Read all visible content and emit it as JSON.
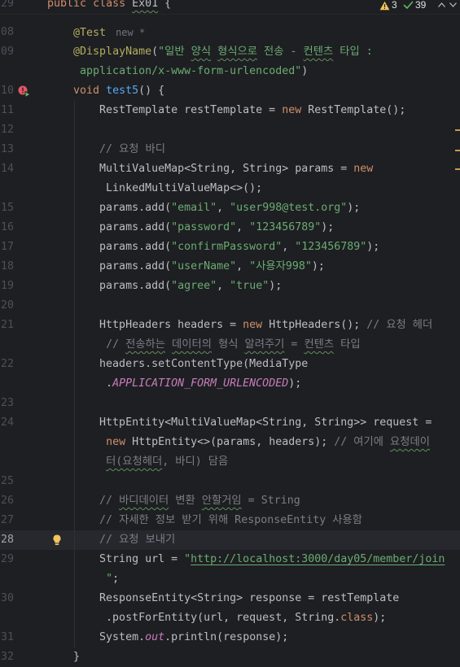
{
  "colors": {
    "background": "#1e1f22",
    "current_line": "#26282e",
    "text": "#bcbec4",
    "keyword": "#cf8e6d",
    "annotation": "#b3ae60",
    "string": "#6aab73",
    "comment": "#7a7e85",
    "method": "#56a8f5",
    "static_field": "#c77dbb",
    "line_number": "#4b5059",
    "line_number_current": "#a1a3ab",
    "hint": "#6f737a",
    "typo": "#5f8f5c",
    "warning": "#f2c55c",
    "success": "#5fb865",
    "error": "#e55765",
    "warning_mark": "#c99a47"
  },
  "editor": {
    "inspections": {
      "warning_icon": "warning-icon",
      "warnings": "3",
      "check_icon": "check-icon",
      "weak_warnings": "39",
      "previous_icon": "chevron-up-icon",
      "next_icon": "chevron-down-icon"
    },
    "sticky": {
      "number": "29",
      "tokens": [
        {
          "type": "keyword",
          "text": "public"
        },
        {
          "type": "plain",
          "text": " "
        },
        {
          "type": "keyword",
          "text": "class"
        },
        {
          "type": "plain",
          "text": " "
        },
        {
          "type": "plain",
          "text": "Ex01",
          "typo": true
        },
        {
          "type": "plain",
          "text": " {"
        }
      ]
    },
    "current_line": "28",
    "rows": [
      {
        "number": "08",
        "tokens": [
          {
            "type": "plain",
            "text": "    "
          },
          {
            "type": "annotation",
            "text": "@Test"
          },
          {
            "type": "hint",
            "text": "new *"
          }
        ]
      },
      {
        "number": "09",
        "tokens": [
          {
            "type": "plain",
            "text": "    "
          },
          {
            "type": "annotation",
            "text": "@DisplayName"
          },
          {
            "type": "plain",
            "text": "("
          },
          {
            "type": "string",
            "text": "\"일반 "
          },
          {
            "type": "string",
            "text": "양식",
            "typo": true
          },
          {
            "type": "string",
            "text": " "
          },
          {
            "type": "string",
            "text": "형식으로",
            "typo": true
          },
          {
            "type": "string",
            "text": " 전송 - "
          },
          {
            "type": "string",
            "text": "컨텐츠",
            "typo": true
          },
          {
            "type": "string",
            "text": " 타입 :"
          }
        ]
      },
      {
        "number": "",
        "tokens": [
          {
            "type": "plain",
            "text": "     "
          },
          {
            "type": "string",
            "text": "application/x-www-form-urlencoded\""
          },
          {
            "type": "plain",
            "text": ")"
          }
        ]
      },
      {
        "number": "10",
        "gutter_icon": "run-test-failed-icon",
        "tokens": [
          {
            "type": "plain",
            "text": "    "
          },
          {
            "type": "keyword",
            "text": "void"
          },
          {
            "type": "plain",
            "text": " "
          },
          {
            "type": "method",
            "text": "test5"
          },
          {
            "type": "plain",
            "text": "() {"
          }
        ]
      },
      {
        "number": "11",
        "tokens": [
          {
            "type": "plain",
            "text": "        RestTemplate restTemplate = "
          },
          {
            "type": "keyword",
            "text": "new"
          },
          {
            "type": "plain",
            "text": " RestTemplate();"
          }
        ]
      },
      {
        "number": "12",
        "tokens": []
      },
      {
        "number": "13",
        "tokens": [
          {
            "type": "plain",
            "text": "        "
          },
          {
            "type": "comment",
            "text": "// 요청 바디"
          }
        ]
      },
      {
        "number": "14",
        "tokens": [
          {
            "type": "plain",
            "text": "        MultiValueMap<String, String> params = "
          },
          {
            "type": "keyword",
            "text": "new"
          }
        ]
      },
      {
        "number": "",
        "tokens": [
          {
            "type": "plain",
            "text": "         LinkedMultiValueMap<>();"
          }
        ]
      },
      {
        "number": "15",
        "tokens": [
          {
            "type": "plain",
            "text": "        params.add("
          },
          {
            "type": "string",
            "text": "\"email\""
          },
          {
            "type": "plain",
            "text": ", "
          },
          {
            "type": "string",
            "text": "\"user998@test.org\""
          },
          {
            "type": "plain",
            "text": ");"
          }
        ]
      },
      {
        "number": "16",
        "tokens": [
          {
            "type": "plain",
            "text": "        params.add("
          },
          {
            "type": "string",
            "text": "\"password\""
          },
          {
            "type": "plain",
            "text": ", "
          },
          {
            "type": "string",
            "text": "\"123456789\""
          },
          {
            "type": "plain",
            "text": ");"
          }
        ]
      },
      {
        "number": "17",
        "tokens": [
          {
            "type": "plain",
            "text": "        params.add("
          },
          {
            "type": "string",
            "text": "\"confirmPassword\""
          },
          {
            "type": "plain",
            "text": ", "
          },
          {
            "type": "string",
            "text": "\"123456789\""
          },
          {
            "type": "plain",
            "text": ");"
          }
        ]
      },
      {
        "number": "18",
        "tokens": [
          {
            "type": "plain",
            "text": "        params.add("
          },
          {
            "type": "string",
            "text": "\"userName\""
          },
          {
            "type": "plain",
            "text": ", "
          },
          {
            "type": "string",
            "text": "\"사용자998\""
          },
          {
            "type": "plain",
            "text": ");"
          }
        ]
      },
      {
        "number": "19",
        "tokens": [
          {
            "type": "plain",
            "text": "        params.add("
          },
          {
            "type": "string",
            "text": "\"agree\""
          },
          {
            "type": "plain",
            "text": ", "
          },
          {
            "type": "string",
            "text": "\"true\""
          },
          {
            "type": "plain",
            "text": ");"
          }
        ]
      },
      {
        "number": "20",
        "tokens": []
      },
      {
        "number": "21",
        "tokens": [
          {
            "type": "plain",
            "text": "        HttpHeaders headers = "
          },
          {
            "type": "keyword",
            "text": "new"
          },
          {
            "type": "plain",
            "text": " HttpHeaders(); "
          },
          {
            "type": "comment",
            "text": "// 요청 헤더"
          }
        ]
      },
      {
        "number": "",
        "tokens": [
          {
            "type": "plain",
            "text": "         "
          },
          {
            "type": "comment",
            "text": "// "
          },
          {
            "type": "comment",
            "text": "전송하는",
            "typo": true
          },
          {
            "type": "comment",
            "text": " "
          },
          {
            "type": "comment",
            "text": "데이터의",
            "typo": true
          },
          {
            "type": "comment",
            "text": " 형식 "
          },
          {
            "type": "comment",
            "text": "알려주기",
            "typo": true
          },
          {
            "type": "comment",
            "text": " = "
          },
          {
            "type": "comment",
            "text": "컨텐츠",
            "typo": true
          },
          {
            "type": "comment",
            "text": " 타입"
          }
        ]
      },
      {
        "number": "22",
        "tokens": [
          {
            "type": "plain",
            "text": "        headers.setContentType(MediaType"
          }
        ]
      },
      {
        "number": "",
        "tokens": [
          {
            "type": "plain",
            "text": "         ."
          },
          {
            "type": "static",
            "text": "APPLICATION_FORM_URLENCODED"
          },
          {
            "type": "plain",
            "text": ");"
          }
        ]
      },
      {
        "number": "23",
        "tokens": []
      },
      {
        "number": "24",
        "tokens": [
          {
            "type": "plain",
            "text": "        HttpEntity<MultiValueMap<String, String>> request ="
          }
        ]
      },
      {
        "number": "",
        "tokens": [
          {
            "type": "plain",
            "text": "         "
          },
          {
            "type": "keyword",
            "text": "new"
          },
          {
            "type": "plain",
            "text": " HttpEntity<>(params, headers); "
          },
          {
            "type": "comment",
            "text": "// 여기에 "
          },
          {
            "type": "comment",
            "text": "요청데이",
            "typo": true
          }
        ]
      },
      {
        "number": "",
        "tokens": [
          {
            "type": "plain",
            "text": "         "
          },
          {
            "type": "comment",
            "text": "터(요청헤더",
            "typo": true
          },
          {
            "type": "comment",
            "text": ", 바디) 담음"
          }
        ]
      },
      {
        "number": "25",
        "tokens": []
      },
      {
        "number": "26",
        "tokens": [
          {
            "type": "plain",
            "text": "        "
          },
          {
            "type": "comment",
            "text": "// "
          },
          {
            "type": "comment",
            "text": "바디데이터",
            "typo": true
          },
          {
            "type": "comment",
            "text": " 변환 "
          },
          {
            "type": "comment",
            "text": "안할거임",
            "typo": true
          },
          {
            "type": "comment",
            "text": " = String"
          }
        ]
      },
      {
        "number": "27",
        "tokens": [
          {
            "type": "plain",
            "text": "        "
          },
          {
            "type": "comment",
            "text": "// 자세한 정보 받기 위해 ResponseEntity 사용함"
          }
        ]
      },
      {
        "number": "28",
        "intention_icon": "lightbulb-icon",
        "tokens": [
          {
            "type": "plain",
            "text": "        "
          },
          {
            "type": "comment",
            "text": "// 요청 보내기"
          }
        ]
      },
      {
        "number": "29",
        "tokens": [
          {
            "type": "plain",
            "text": "        String url = "
          },
          {
            "type": "string",
            "text": "\""
          },
          {
            "type": "link",
            "text": "http://localhost:3000/day05/member/join"
          }
        ]
      },
      {
        "number": "",
        "tokens": [
          {
            "type": "plain",
            "text": "         "
          },
          {
            "type": "string",
            "text": "\""
          },
          {
            "type": "plain",
            "text": ";"
          }
        ]
      },
      {
        "number": "30",
        "tokens": [
          {
            "type": "plain",
            "text": "        ResponseEntity<String> response = restTemplate"
          }
        ]
      },
      {
        "number": "",
        "tokens": [
          {
            "type": "plain",
            "text": "         .postForEntity(url, request, String."
          },
          {
            "type": "keyword",
            "text": "class"
          },
          {
            "type": "plain",
            "text": ");"
          }
        ]
      },
      {
        "number": "31",
        "tokens": [
          {
            "type": "plain",
            "text": "        System."
          },
          {
            "type": "static",
            "text": "out"
          },
          {
            "type": "plain",
            "text": ".println(response);"
          }
        ]
      },
      {
        "number": "32",
        "tokens": [
          {
            "type": "plain",
            "text": "    }"
          }
        ]
      }
    ]
  }
}
